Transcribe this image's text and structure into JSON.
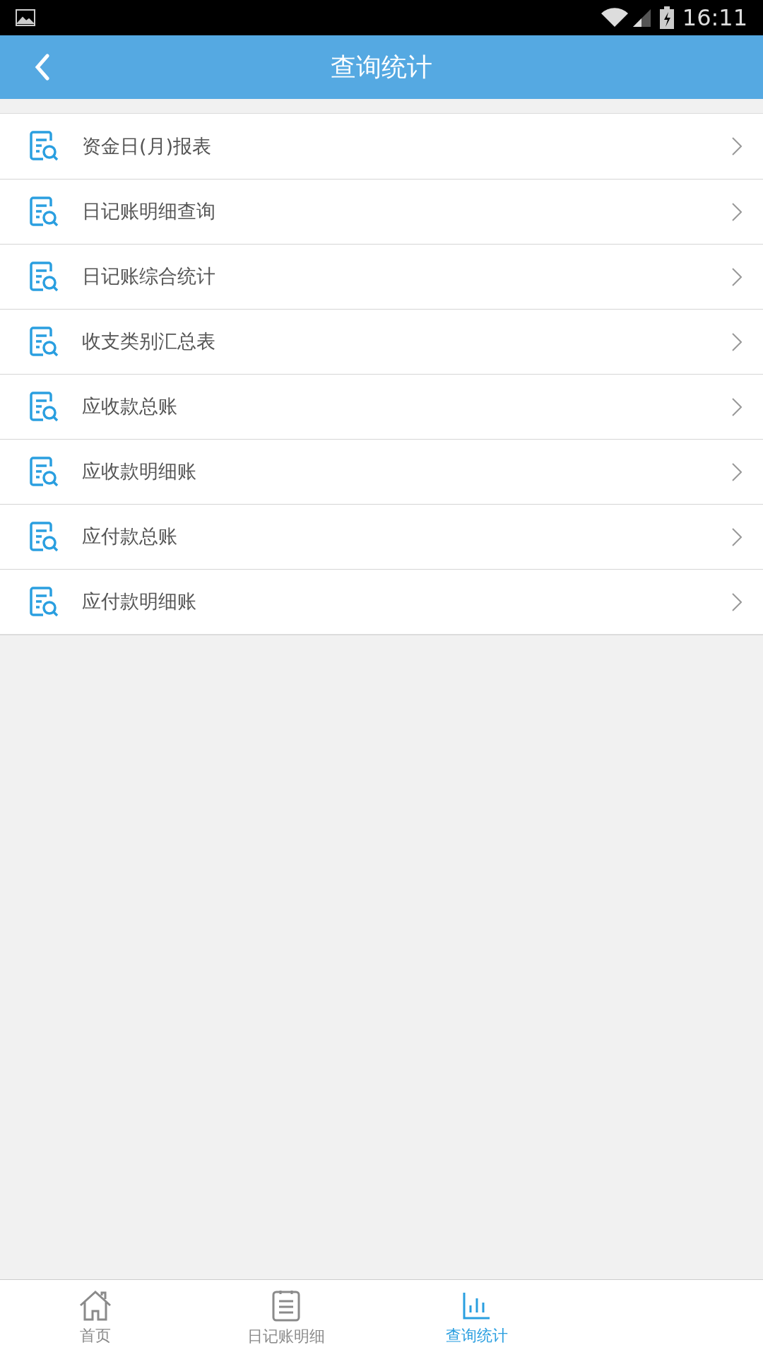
{
  "status_bar": {
    "time": "16:11"
  },
  "header": {
    "title": "查询统计"
  },
  "menu": [
    {
      "label": "资金日(月)报表"
    },
    {
      "label": "日记账明细查询"
    },
    {
      "label": "日记账综合统计"
    },
    {
      "label": "收支类别汇总表"
    },
    {
      "label": "应收款总账"
    },
    {
      "label": "应收款明细账"
    },
    {
      "label": "应付款总账"
    },
    {
      "label": "应付款明细账"
    }
  ],
  "tabs": [
    {
      "label": "首页",
      "kind": "home",
      "selected": false
    },
    {
      "label": "日记账明细",
      "kind": "journal",
      "selected": false
    },
    {
      "label": "查询统计",
      "kind": "stats",
      "selected": true
    }
  ]
}
